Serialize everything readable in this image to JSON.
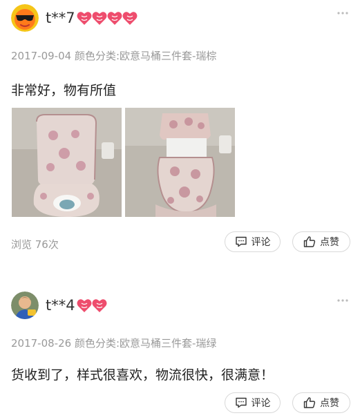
{
  "reviews": [
    {
      "username": "t**7",
      "heart_count": 4,
      "date": "2017-09-04",
      "variant": "颜色分类:欧意马桶三件套-瑞棕",
      "content": "非常好，物有所值",
      "views": "浏览 76次",
      "comment_label": "评论",
      "like_label": "点赞",
      "avatar_icon": "sunglasses-emoji-avatar",
      "photos": [
        "toilet-cover-photo-front",
        "toilet-cover-photo-side"
      ]
    },
    {
      "username": "t**4",
      "heart_count": 2,
      "date": "2017-08-26",
      "variant": "颜色分类:欧意马桶三件套-瑞绿",
      "content": "货收到了，样式很喜欢，物流很快，很满意！",
      "comment_label": "评论",
      "like_label": "点赞",
      "avatar_icon": "child-photo-avatar"
    }
  ],
  "colors": {
    "heart": "#ee4d6d",
    "meta_text": "#999999",
    "button_border": "#d8d8d8"
  }
}
